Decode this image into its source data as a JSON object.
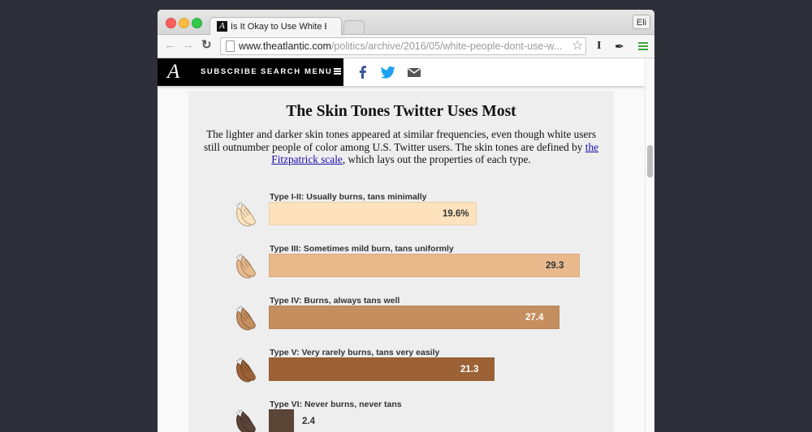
{
  "browser": {
    "tab": {
      "title": "Is It Okay to Use White Emoji?",
      "favicon": "A",
      "close_glyph": "✕"
    },
    "profile": "Eli",
    "url": {
      "prefix": "www.",
      "host": "theatlantic.com",
      "path": "/politics/archive/2016/05/white-people-dont-use-w..."
    },
    "icons": {
      "back": "←",
      "forward": "→",
      "reload": "↻",
      "star": "☆",
      "ext_instapaper": "I",
      "ext_pin": "✒"
    }
  },
  "site": {
    "logo": "A",
    "nav": {
      "subscribe": "SUBSCRIBE",
      "search": "SEARCH",
      "menu": "MENU"
    }
  },
  "graphic": {
    "title": "The Skin Tones Twitter Uses Most",
    "desc_before": "The lighter and darker skin tones appeared at similar frequencies, even though white users still outnumber people of color among U.S. Twitter users. The skin tones are defined by ",
    "desc_link": "the Fitzpatrick scale",
    "desc_after": ", which lays out the properties of each type."
  },
  "chart_data": {
    "type": "bar",
    "orientation": "horizontal",
    "title": "The Skin Tones Twitter Uses Most",
    "xlim": [
      0,
      30
    ],
    "categories": [
      "Type I-II: Usually burns, tans minimally",
      "Type III: Sometimes mild burn, tans uniformly",
      "Type IV: Burns, always tans well",
      "Type V: Very rarely burns, tans very easily",
      "Type VI: Never burns, never tans"
    ],
    "values": [
      19.6,
      29.3,
      27.4,
      21.3,
      2.4
    ],
    "value_labels": [
      "19.6%",
      "29.3",
      "27.4",
      "21.3",
      "2.4"
    ],
    "colors": [
      "#fde2bd",
      "#e9b98c",
      "#c48e5e",
      "#9c6236",
      "#5b4537"
    ],
    "icon": "clapping-hands-icon"
  }
}
